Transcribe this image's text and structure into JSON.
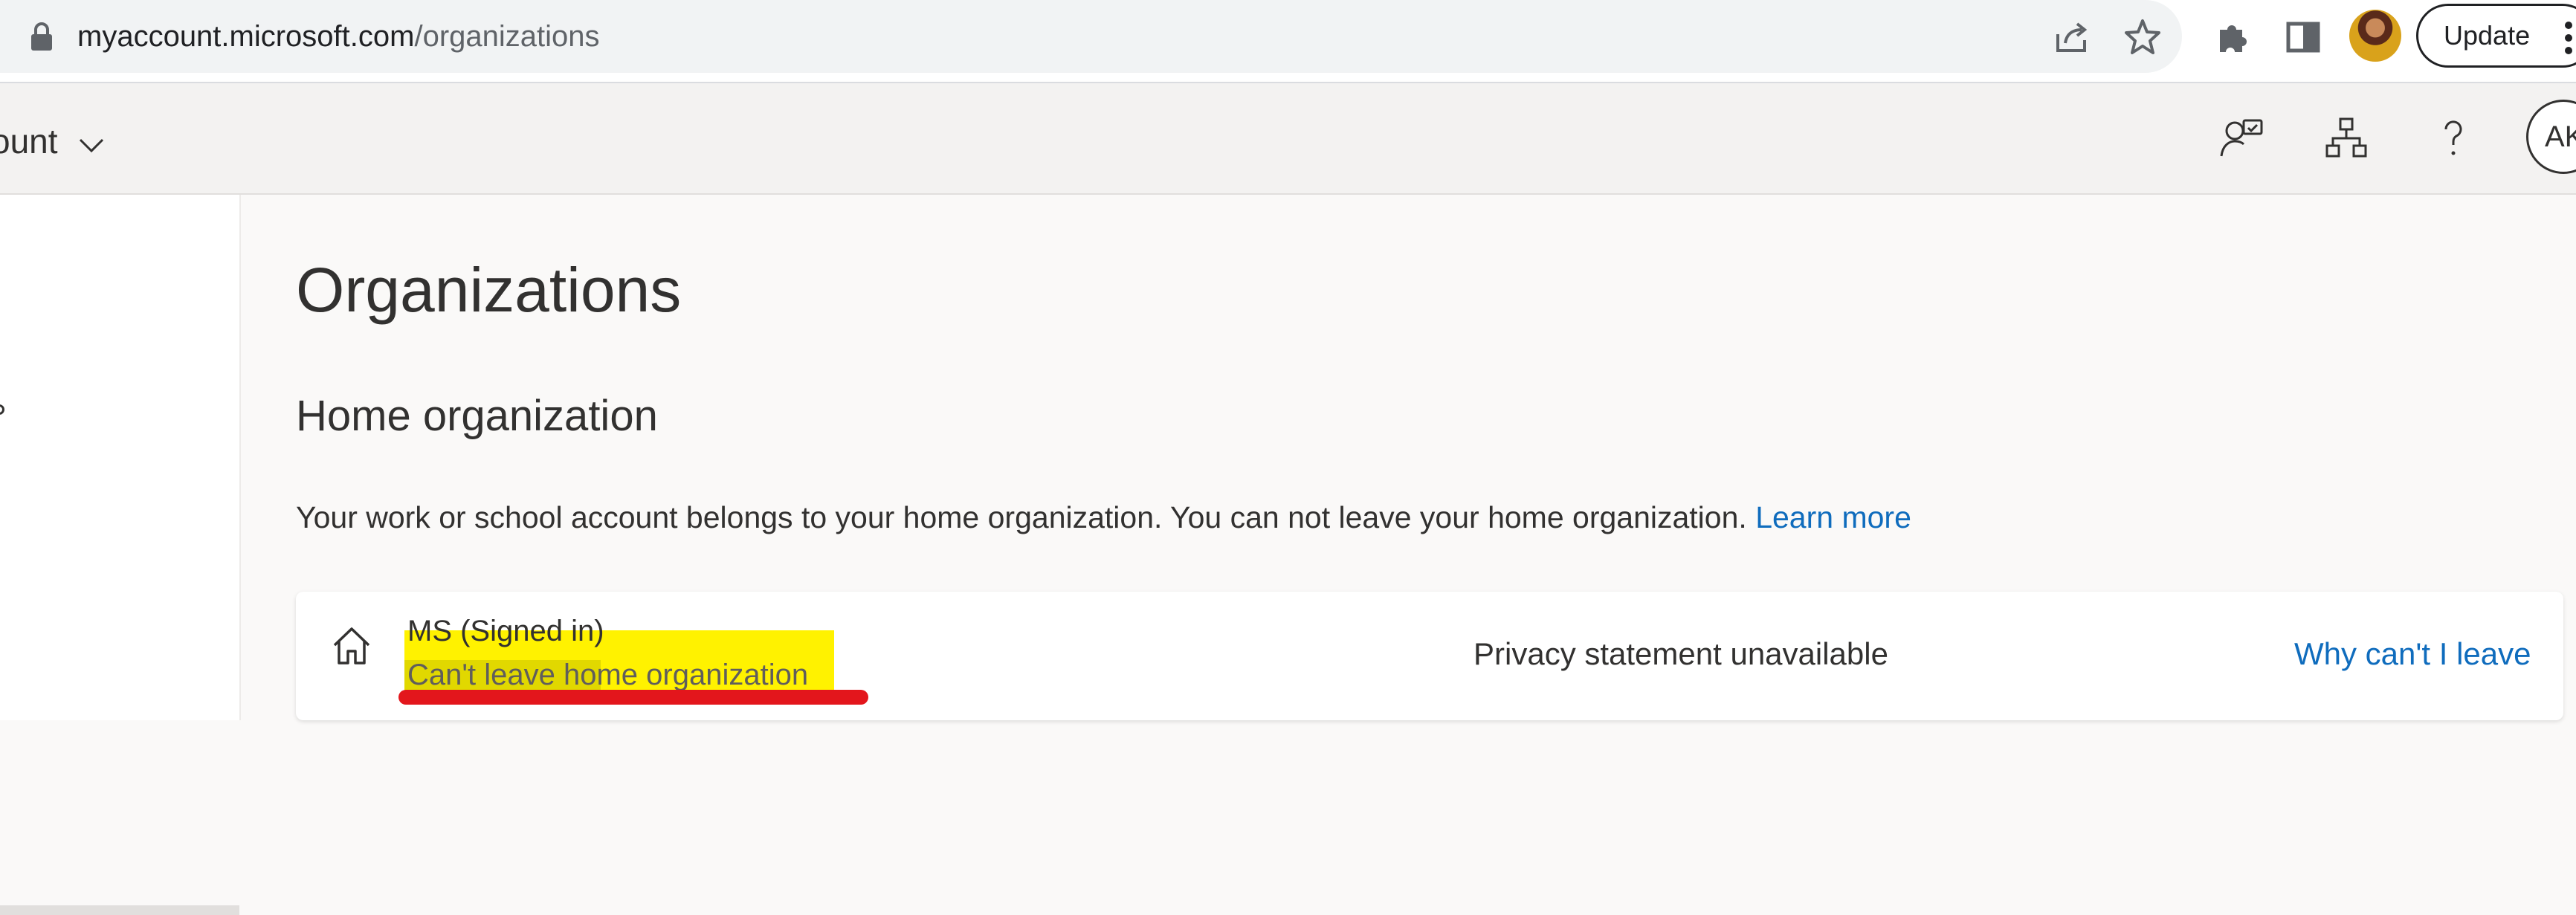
{
  "browser": {
    "url_host": "myaccount.microsoft.com",
    "url_path": "/organizations",
    "update_label": "Update"
  },
  "header": {
    "app_title": "ount",
    "avatar_initials": "AK"
  },
  "main": {
    "page_title": "Organizations",
    "section_title": "Home organization",
    "description": "Your work or school account belongs to your home organization. You can not leave your home organization.",
    "learn_more": "Learn more",
    "org": {
      "name": "MS (Signed in)",
      "status": "Can't leave home organization",
      "privacy": "Privacy statement unavailable",
      "why_link": "Why can't I leave"
    }
  },
  "colors": {
    "link": "#0f6cbd",
    "highlight": "#fff200",
    "annotation_underline": "#e3161c"
  }
}
